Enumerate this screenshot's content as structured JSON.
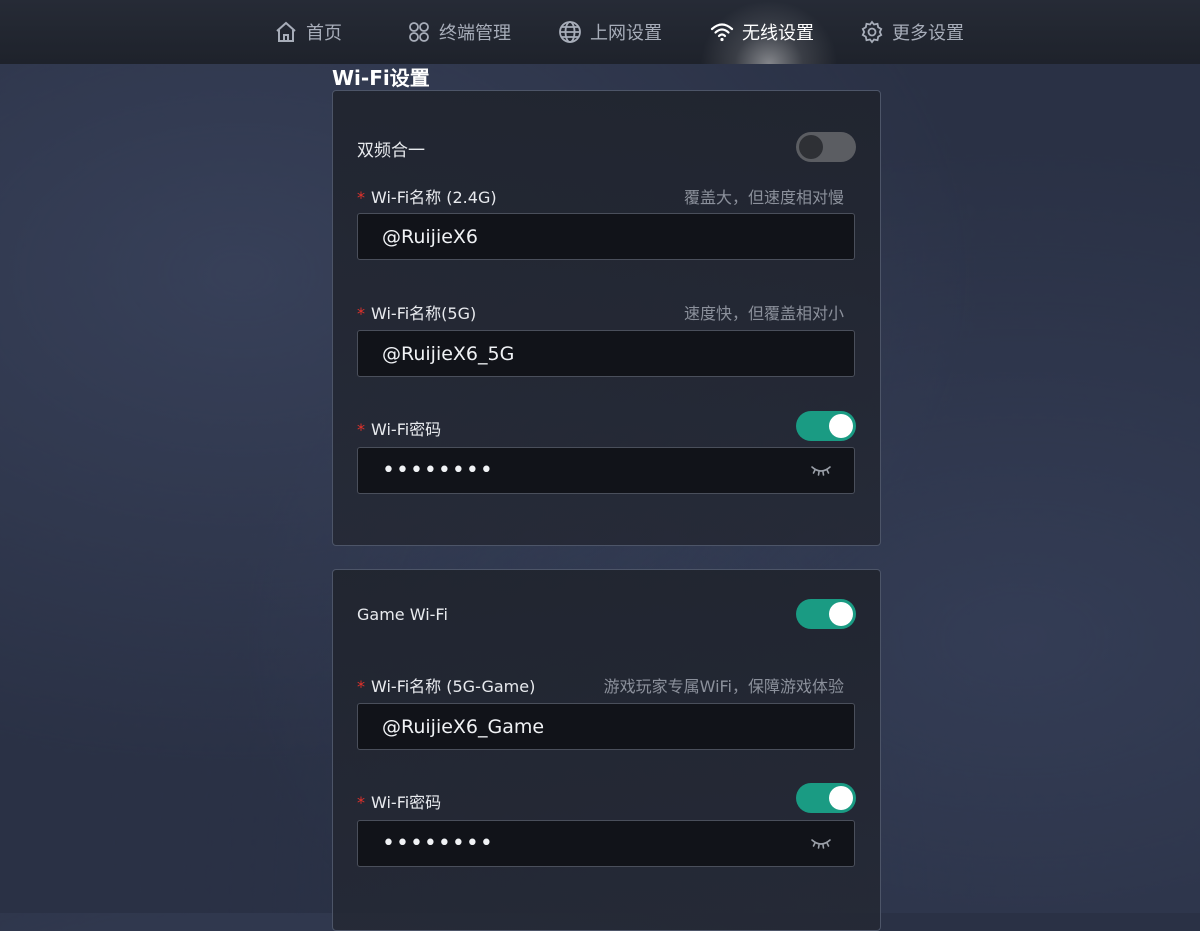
{
  "nav": {
    "items": [
      {
        "label": "首页",
        "icon": "home-icon"
      },
      {
        "label": "终端管理",
        "icon": "devices-icon"
      },
      {
        "label": "上网设置",
        "icon": "globe-icon"
      },
      {
        "label": "无线设置",
        "icon": "wifi-icon",
        "active": true
      },
      {
        "label": "更多设置",
        "icon": "gear-icon"
      }
    ]
  },
  "page": {
    "title": "Wi-Fi设置"
  },
  "card1": {
    "dual_band": {
      "label": "双频合一",
      "enabled": false
    },
    "ssid_24": {
      "label": "Wi-Fi名称 (2.4G)",
      "hint": "覆盖大，但速度相对慢",
      "value": "@RuijieX6"
    },
    "ssid_5": {
      "label": "Wi-Fi名称(5G)",
      "hint": "速度快，但覆盖相对小",
      "value": "@RuijieX6_5G"
    },
    "password": {
      "label": "Wi-Fi密码",
      "enabled": true,
      "value": "••••••••"
    }
  },
  "card2": {
    "game_wifi": {
      "label": "Game Wi-Fi",
      "enabled": true
    },
    "ssid_game": {
      "label": "Wi-Fi名称 (5G-Game)",
      "hint": "游戏玩家专属WiFi，保障游戏体验",
      "value": "@RuijieX6_Game"
    },
    "password": {
      "label": "Wi-Fi密码",
      "enabled": true,
      "value": "••••••••"
    }
  },
  "required_mark": "*",
  "colors": {
    "accent": "#1a9b83",
    "required": "#e2322b",
    "toggle_off": "#5b5d62"
  }
}
